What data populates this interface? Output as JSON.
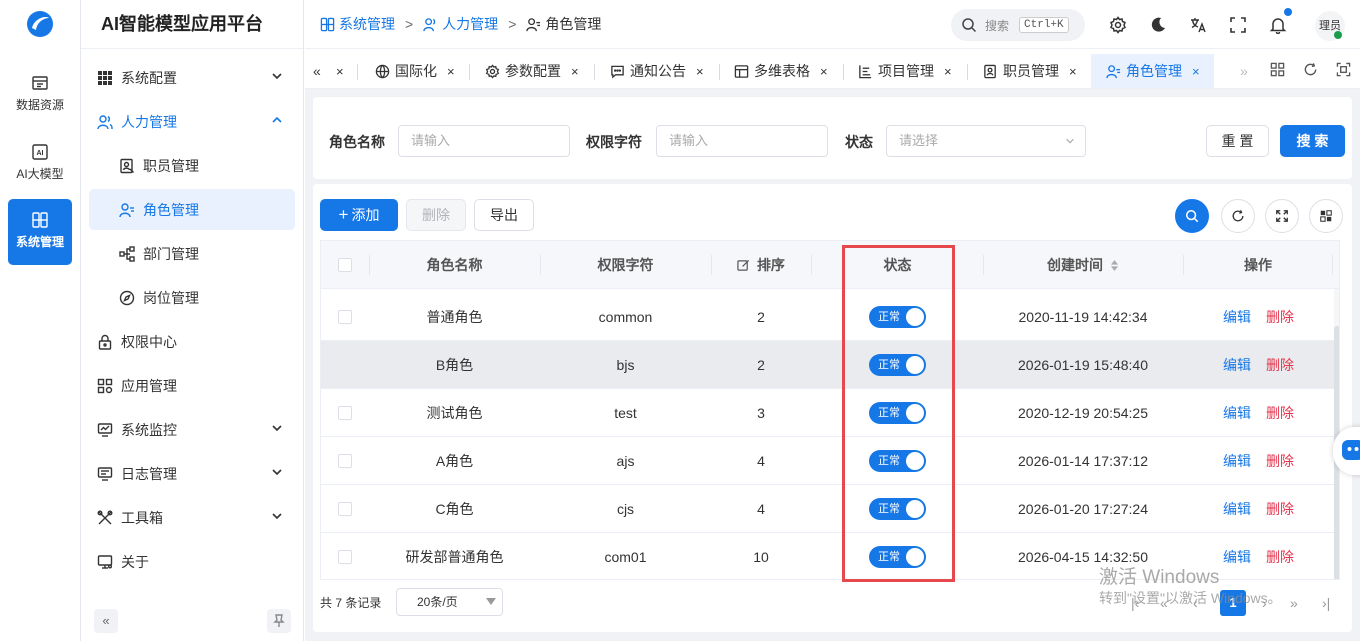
{
  "app": {
    "title": "AI智能模型应用平台"
  },
  "rail": [
    {
      "label": "数据资源",
      "icon": "database-icon"
    },
    {
      "label": "AI大模型",
      "icon": "ai-icon"
    },
    {
      "label": "系统管理",
      "icon": "system-icon"
    }
  ],
  "sidebar": {
    "items": [
      {
        "label": "系统配置",
        "icon": "grid-icon",
        "chevron": "down"
      },
      {
        "label": "人力管理",
        "icon": "users-icon",
        "chevron": "up"
      },
      {
        "label": "职员管理",
        "icon": "employee-icon"
      },
      {
        "label": "角色管理",
        "icon": "role-icon"
      },
      {
        "label": "部门管理",
        "icon": "org-icon"
      },
      {
        "label": "岗位管理",
        "icon": "compass-icon"
      },
      {
        "label": "权限中心",
        "icon": "lock-icon"
      },
      {
        "label": "应用管理",
        "icon": "apps-icon"
      },
      {
        "label": "系统监控",
        "icon": "monitor-icon",
        "chevron": "down"
      },
      {
        "label": "日志管理",
        "icon": "log-icon",
        "chevron": "down"
      },
      {
        "label": "工具箱",
        "icon": "tools-icon",
        "chevron": "down"
      },
      {
        "label": "关于",
        "icon": "about-icon"
      }
    ],
    "collapse_glyph": "«"
  },
  "breadcrumb": [
    {
      "label": "系统管理"
    },
    {
      "label": "人力管理"
    },
    {
      "label": "角色管理"
    }
  ],
  "breadcrumb_sep": ">",
  "header": {
    "search_placeholder": "搜索",
    "shortcut": "Ctrl+K",
    "avatar_text": "理员"
  },
  "tabs": [
    {
      "label": "国际化",
      "icon": "globe-icon"
    },
    {
      "label": "参数配置",
      "icon": "settings-icon"
    },
    {
      "label": "通知公告",
      "icon": "message-icon"
    },
    {
      "label": "多维表格",
      "icon": "table-icon"
    },
    {
      "label": "项目管理",
      "icon": "project-icon"
    },
    {
      "label": "职员管理",
      "icon": "employee-icon"
    },
    {
      "label": "角色管理",
      "icon": "role-icon"
    }
  ],
  "tab_close": "×",
  "tab_prev": "«",
  "tab_next": "»",
  "filter": {
    "role_name_label": "角色名称",
    "role_name_placeholder": "请输入",
    "perm_label": "权限字符",
    "perm_placeholder": "请输入",
    "status_label": "状态",
    "status_placeholder": "请选择",
    "reset": "重 置",
    "search": "搜 索"
  },
  "toolbar": {
    "add": "添加",
    "delete": "删除",
    "export": "导出"
  },
  "table": {
    "columns": [
      "角色名称",
      "权限字符",
      "排序",
      "状态",
      "创建时间",
      "操作"
    ],
    "rows": [
      {
        "name": "普通角色",
        "key": "common",
        "sort": "2",
        "status": "正常",
        "created": "2020-11-19 14:42:34"
      },
      {
        "name": "B角色",
        "key": "bjs",
        "sort": "2",
        "status": "正常",
        "created": "2026-01-19 15:48:40"
      },
      {
        "name": "测试角色",
        "key": "test",
        "sort": "3",
        "status": "正常",
        "created": "2020-12-19 20:54:25"
      },
      {
        "name": "A角色",
        "key": "ajs",
        "sort": "4",
        "status": "正常",
        "created": "2026-01-14 17:37:12"
      },
      {
        "name": "C角色",
        "key": "cjs",
        "sort": "4",
        "status": "正常",
        "created": "2026-01-20 17:27:24"
      },
      {
        "name": "研发部普通角色",
        "key": "com01",
        "sort": "10",
        "status": "正常",
        "created": "2026-04-15 14:32:50"
      }
    ],
    "edit": "编辑",
    "delete": "删除"
  },
  "pagination": {
    "total": "共 7 条记录",
    "page_size": "20条/页",
    "current": "1"
  },
  "watermark": {
    "line1": "激活 Windows",
    "line2": "转到\"设置\"以激活 Windows。"
  },
  "colors": {
    "primary": "#1677e6",
    "danger": "#e3344c",
    "highlight": "#e5484d"
  }
}
